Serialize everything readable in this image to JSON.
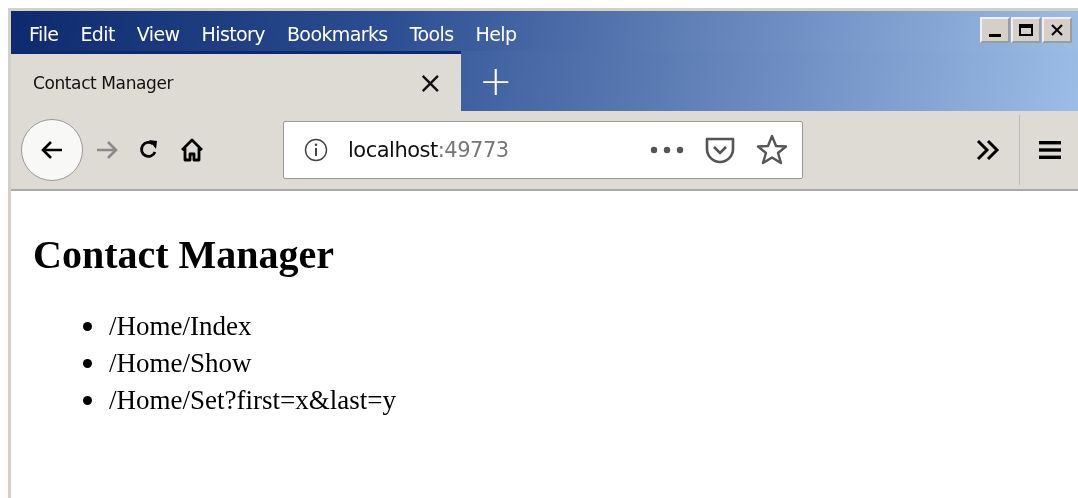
{
  "menu_bar": [
    "File",
    "Edit",
    "View",
    "History",
    "Bookmarks",
    "Tools",
    "Help"
  ],
  "tabs": [
    {
      "label": "Contact Manager",
      "selected": true,
      "close": "×"
    }
  ],
  "new_tab": "+",
  "toolbar": {
    "back_disabled": false,
    "forward_disabled": true
  },
  "address_bar": {
    "host": "localhost",
    "port": ":49773"
  },
  "page": {
    "heading": "Contact Manager",
    "links": [
      "/Home/Index",
      "/Home/Show",
      "/Home/Set?first=x&last=y"
    ]
  }
}
